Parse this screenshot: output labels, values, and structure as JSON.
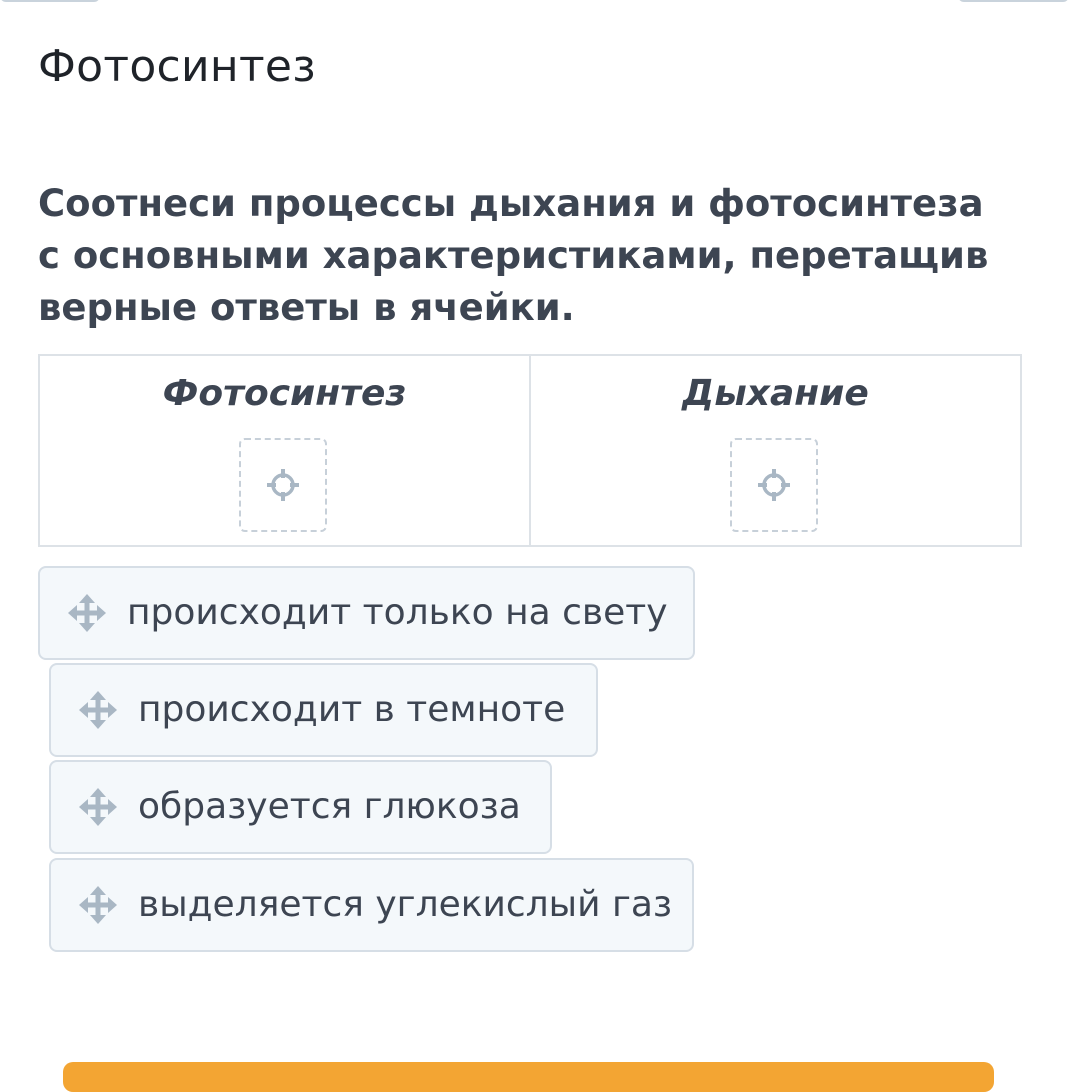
{
  "page": {
    "title": "Фотосинтез"
  },
  "task": {
    "question": "Соотнеси процессы дыхания и фотосинтеза с основными характеристиками, перетащив верные ответы в ячейки."
  },
  "table": {
    "columns": [
      {
        "header": "Фотосинтез",
        "drop_icon": "crosshair-icon"
      },
      {
        "header": "Дыхание",
        "drop_icon": "crosshair-icon"
      }
    ]
  },
  "options": [
    {
      "label": "происходит только на свету",
      "icon": "move-icon"
    },
    {
      "label": "происходит в темноте",
      "icon": "move-icon"
    },
    {
      "label": "образуется глюкоза",
      "icon": "move-icon"
    },
    {
      "label": "выделяется углекислый газ",
      "icon": "move-icon"
    }
  ],
  "colors": {
    "accent": "#f3a533",
    "card_background": "#f4f8fb",
    "border": "#d6dee6",
    "icon": "#a9b7c4",
    "text": "#3d4552"
  }
}
